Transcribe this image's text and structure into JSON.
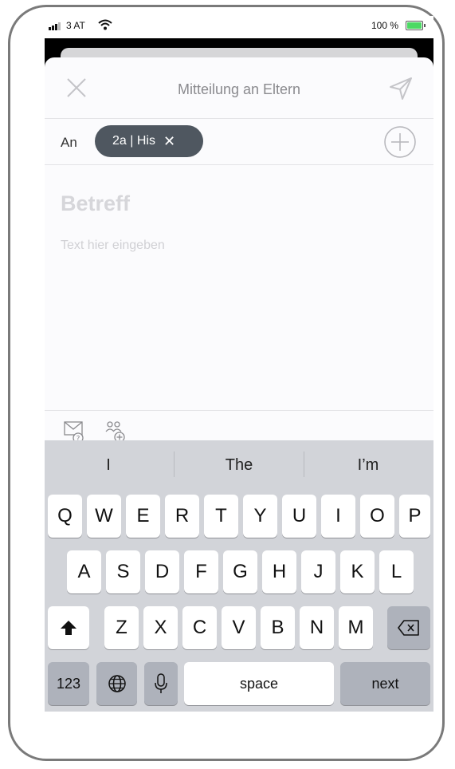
{
  "status": {
    "carrier": "3 AT",
    "battery": "100 %"
  },
  "header": {
    "title": "Mitteilung an Eltern"
  },
  "recipients": {
    "to_label": "An",
    "chip_label": "2a | His",
    "chip_remove": "✕"
  },
  "compose": {
    "subject_placeholder": "Betreff",
    "body_placeholder": "Text hier eingeben"
  },
  "keyboard": {
    "suggestions": [
      "I",
      "The",
      "I’m"
    ],
    "row1": [
      "Q",
      "W",
      "E",
      "R",
      "T",
      "Y",
      "U",
      "I",
      "O",
      "P"
    ],
    "row2": [
      "A",
      "S",
      "D",
      "F",
      "G",
      "H",
      "J",
      "K",
      "L"
    ],
    "row3": [
      "Z",
      "X",
      "C",
      "V",
      "B",
      "N",
      "M"
    ],
    "numbers": "123",
    "space": "space",
    "next": "next"
  }
}
